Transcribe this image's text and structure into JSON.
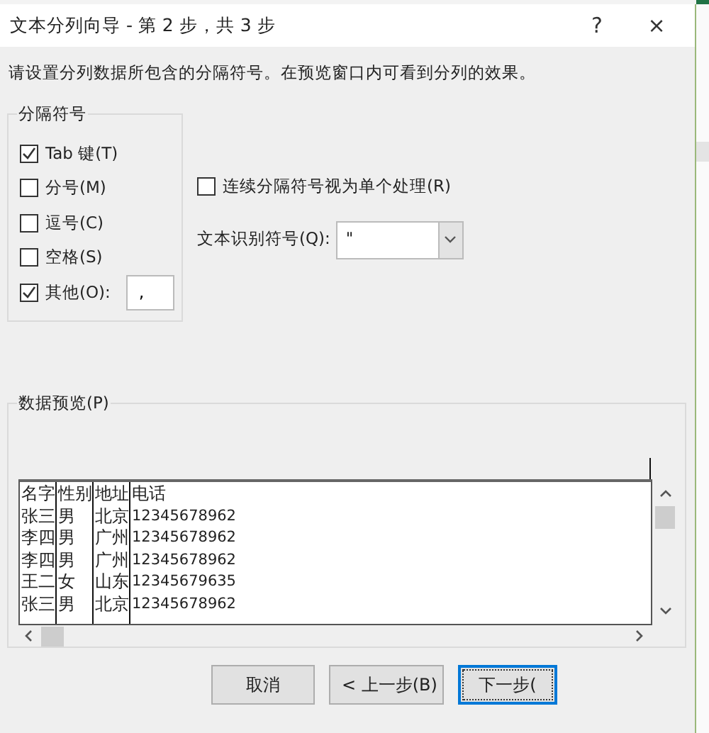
{
  "window": {
    "title": "文本分列向导 - 第 2 步，共 3 步",
    "help": "?",
    "close": "×"
  },
  "instruction": "请设置分列数据所包含的分隔符号。在预览窗口内可看到分列的效果。",
  "delimiters": {
    "title": "分隔符号",
    "items": [
      {
        "label": "Tab 键(T)",
        "checked": true
      },
      {
        "label": "分号(M)",
        "checked": false
      },
      {
        "label": "逗号(C)",
        "checked": false
      },
      {
        "label": "空格(S)",
        "checked": false
      },
      {
        "label": "其他(O):",
        "checked": true,
        "value": ","
      }
    ]
  },
  "treat_consecutive": {
    "label": "连续分隔符号视为单个处理(R)",
    "checked": false
  },
  "text_qualifier": {
    "label": "文本识别符号(Q):",
    "value": "\""
  },
  "preview": {
    "title": "数据预览(P)",
    "rows": [
      [
        "名字",
        "性别",
        "地址",
        "电话"
      ],
      [
        "张三",
        "男",
        "北京",
        "12345678962"
      ],
      [
        "李四",
        "男",
        "广州",
        "12345678962"
      ],
      [
        "李四",
        "男",
        "广州",
        "12345678962"
      ],
      [
        "王二",
        "女",
        "山东",
        "12345679635"
      ],
      [
        "张三",
        "男",
        "北京",
        "12345678962"
      ]
    ]
  },
  "buttons": [
    {
      "label": "取消",
      "focused": false
    },
    {
      "label": "< 上一步(B)",
      "focused": false
    },
    {
      "label": "下一步(",
      "focused": true
    }
  ]
}
